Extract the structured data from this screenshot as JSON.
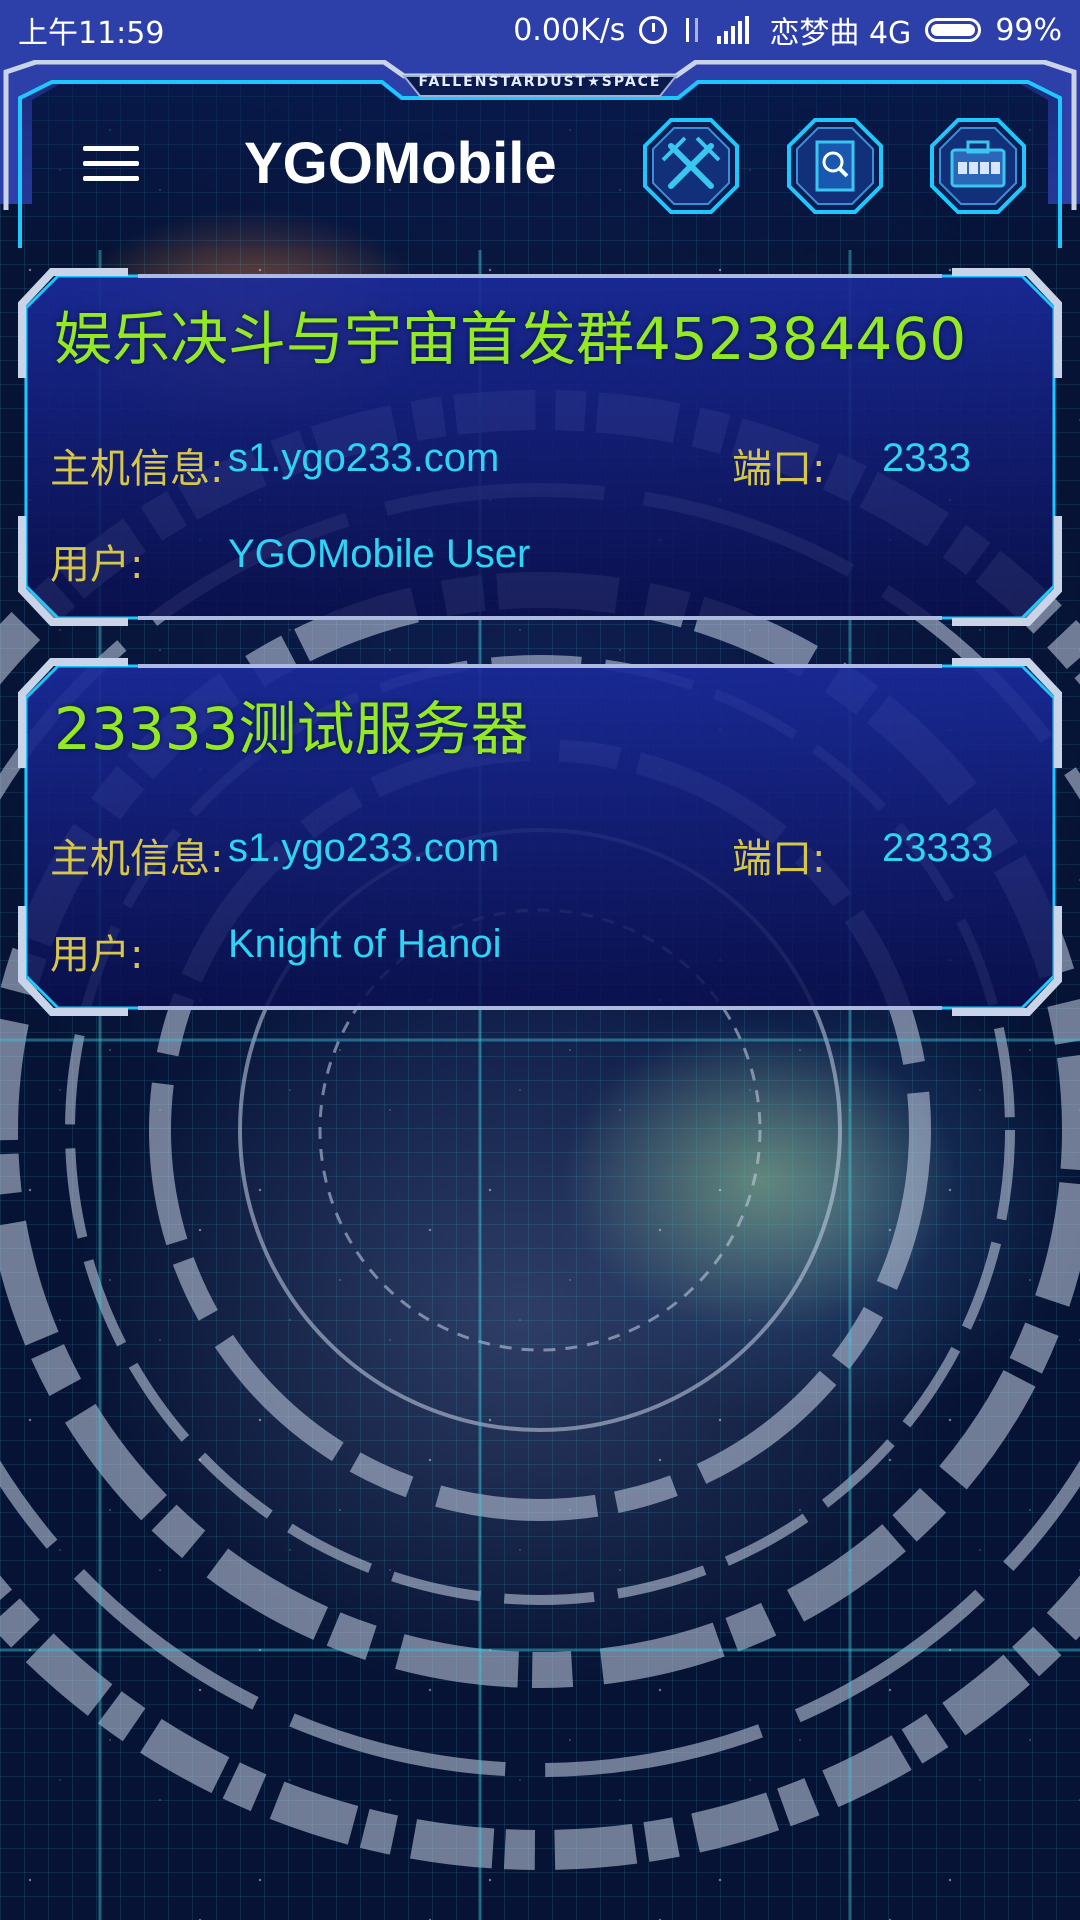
{
  "status_bar": {
    "time": "上午11:59",
    "speed": "0.00K/s",
    "carrier": "恋梦曲 4G",
    "battery": "99%",
    "battery_level": 0.99
  },
  "app_bar": {
    "title": "YGOMobile",
    "frame_caption": "FALLENSTARDUST★SPACE",
    "actions": [
      {
        "icon": "duel-swords-icon"
      },
      {
        "icon": "card-search-icon"
      },
      {
        "icon": "deck-box-icon"
      }
    ]
  },
  "servers": [
    {
      "name": "娱乐决斗与宇宙首发群452384460",
      "host_label": "主机信息:",
      "host": "s1.ygo233.com",
      "port_label": "端口:",
      "port": "2333",
      "user_label": "用户:",
      "user": "YGOMobile User"
    },
    {
      "name": "23333测试服务器",
      "host_label": "主机信息:",
      "host": "s1.ygo233.com",
      "port_label": "端口:",
      "port": "23333",
      "user_label": "用户:",
      "user": "Knight of Hanoi"
    }
  ],
  "colors": {
    "status_bar": "#2d3fa8",
    "server_name": "#93ea22",
    "label": "#d6c64a",
    "value": "#2ed4f4",
    "frame_glow": "#1ec8ff"
  }
}
